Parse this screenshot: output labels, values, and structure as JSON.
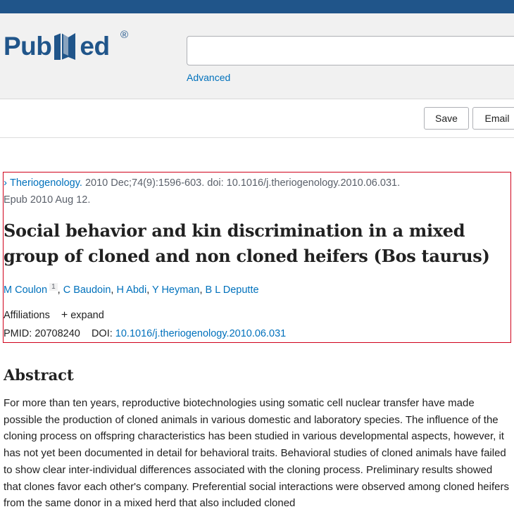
{
  "header": {
    "logo_text_left": "Pub",
    "logo_text_right": "ed",
    "logo_registered": "®",
    "search_placeholder": "",
    "advanced_label": "Advanced"
  },
  "toolbar": {
    "save_label": "Save",
    "email_label": "Email"
  },
  "citation": {
    "journal": "Theriogenology.",
    "details": "2010 Dec;74(9):1596-603. doi: 10.1016/j.theriogenology.2010.06.031.",
    "epub": "Epub 2010 Aug 12."
  },
  "article": {
    "title": "Social behavior and kin discrimination in a mixed group of cloned and non cloned heifers (Bos taurus)",
    "authors": [
      {
        "name": "M Coulon",
        "sup": "1"
      },
      {
        "name": "C Baudoin"
      },
      {
        "name": "H Abdi"
      },
      {
        "name": "Y Heyman"
      },
      {
        "name": "B L Deputte"
      }
    ],
    "affiliations_label": "Affiliations",
    "expand_label": "expand",
    "pmid_label": "PMID:",
    "pmid_value": "20708240",
    "doi_label": "DOI:",
    "doi_value": "10.1016/j.theriogenology.2010.06.031"
  },
  "abstract": {
    "heading": "Abstract",
    "text": "For more than ten years, reproductive biotechnologies using somatic cell nuclear transfer have made possible the production of cloned animals in various domestic and laboratory species. The influence of the cloning process on offspring characteristics has been studied in various developmental aspects, however, it has not yet been documented in detail for behavioral traits. Behavioral studies of cloned animals have failed to show clear inter-individual differences associated with the cloning process. Preliminary results showed that clones favor each other's company. Preferential social interactions were observed among cloned heifers from the same donor in a mixed herd that also included cloned"
  },
  "colors": {
    "brand": "#20558a",
    "link": "#0071bc",
    "highlight_border": "#d0021b"
  },
  "icons": [
    "chevron-right-icon",
    "plus-icon",
    "pubmed-logo-book-icon"
  ]
}
